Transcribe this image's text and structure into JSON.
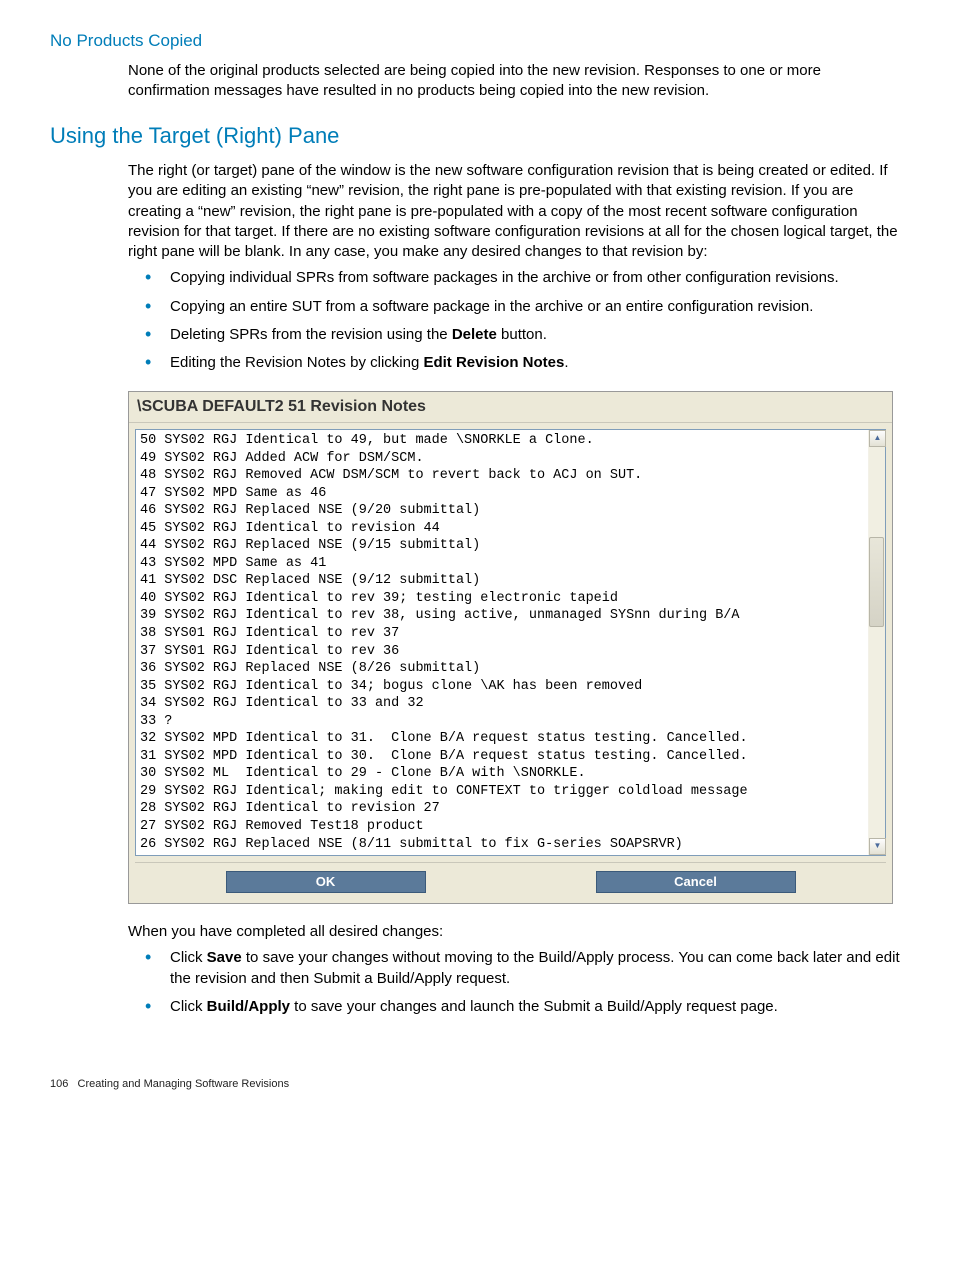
{
  "sub1": {
    "title": "No Products Copied",
    "para": "None of the original products selected are being copied into the new revision. Responses to one or more confirmation messages have resulted in no products being copied into the new revision."
  },
  "section": {
    "title": "Using the Target (Right) Pane",
    "para": "The right (or target) pane of the window is the new software configuration revision that is being created or edited. If you are editing an existing “new” revision, the right pane is pre-populated with that existing revision. If you are creating a “new” revision, the right pane is pre-populated with a copy of the most recent software configuration revision for that target. If there are no existing software configuration revisions at all for the chosen logical target, the right pane will be blank. In any case, you make any desired changes to that revision by:",
    "b1": "Copying individual SPRs from software packages in the archive or from other configuration revisions.",
    "b2": "Copying an entire SUT from a software package in the archive or an entire configuration revision.",
    "b3a": "Deleting SPRs from the revision using the ",
    "b3b": "Delete",
    "b3c": " button.",
    "b4a": "Editing the Revision Notes by clicking ",
    "b4b": "Edit Revision Notes",
    "b4c": "."
  },
  "dialog": {
    "title": "\\SCUBA DEFAULT2 51 Revision Notes",
    "notes": "50 SYS02 RGJ Identical to 49, but made \\SNORKLE a Clone.\n49 SYS02 RGJ Added ACW for DSM/SCM.\n48 SYS02 RGJ Removed ACW DSM/SCM to revert back to ACJ on SUT.\n47 SYS02 MPD Same as 46\n46 SYS02 RGJ Replaced NSE (9/20 submittal)\n45 SYS02 RGJ Identical to revision 44\n44 SYS02 RGJ Replaced NSE (9/15 submittal)\n43 SYS02 MPD Same as 41\n41 SYS02 DSC Replaced NSE (9/12 submittal)\n40 SYS02 RGJ Identical to rev 39; testing electronic tapeid\n39 SYS02 RGJ Identical to rev 38, using active, unmanaged SYSnn during B/A\n38 SYS01 RGJ Identical to rev 37\n37 SYS01 RGJ Identical to rev 36\n36 SYS02 RGJ Replaced NSE (8/26 submittal)\n35 SYS02 RGJ Identical to 34; bogus clone \\AK has been removed\n34 SYS02 RGJ Identical to 33 and 32\n33 ?\n32 SYS02 MPD Identical to 31.  Clone B/A request status testing. Cancelled.\n31 SYS02 MPD Identical to 30.  Clone B/A request status testing. Cancelled.\n30 SYS02 ML  Identical to 29 - Clone B/A with \\SNORKLE.\n29 SYS02 RGJ Identical; making edit to CONFTEXT to trigger coldload message\n28 SYS02 RGJ Identical to revision 27\n27 SYS02 RGJ Removed Test18 product\n26 SYS02 RGJ Replaced NSE (8/11 submittal to fix G-series SOAPSRVR)",
    "ok": "OK",
    "cancel": "Cancel"
  },
  "after": {
    "para": "When you have completed all desired changes:",
    "b1a": "Click ",
    "b1b": "Save",
    "b1c": " to save your changes without moving to the Build/Apply process. You can come back later and edit the revision and then Submit a Build/Apply request.",
    "b2a": "Click ",
    "b2b": "Build/Apply",
    "b2c": " to save your changes and launch the Submit a Build/Apply request page."
  },
  "footer": {
    "page": "106",
    "chap": "Creating and Managing Software Revisions"
  }
}
